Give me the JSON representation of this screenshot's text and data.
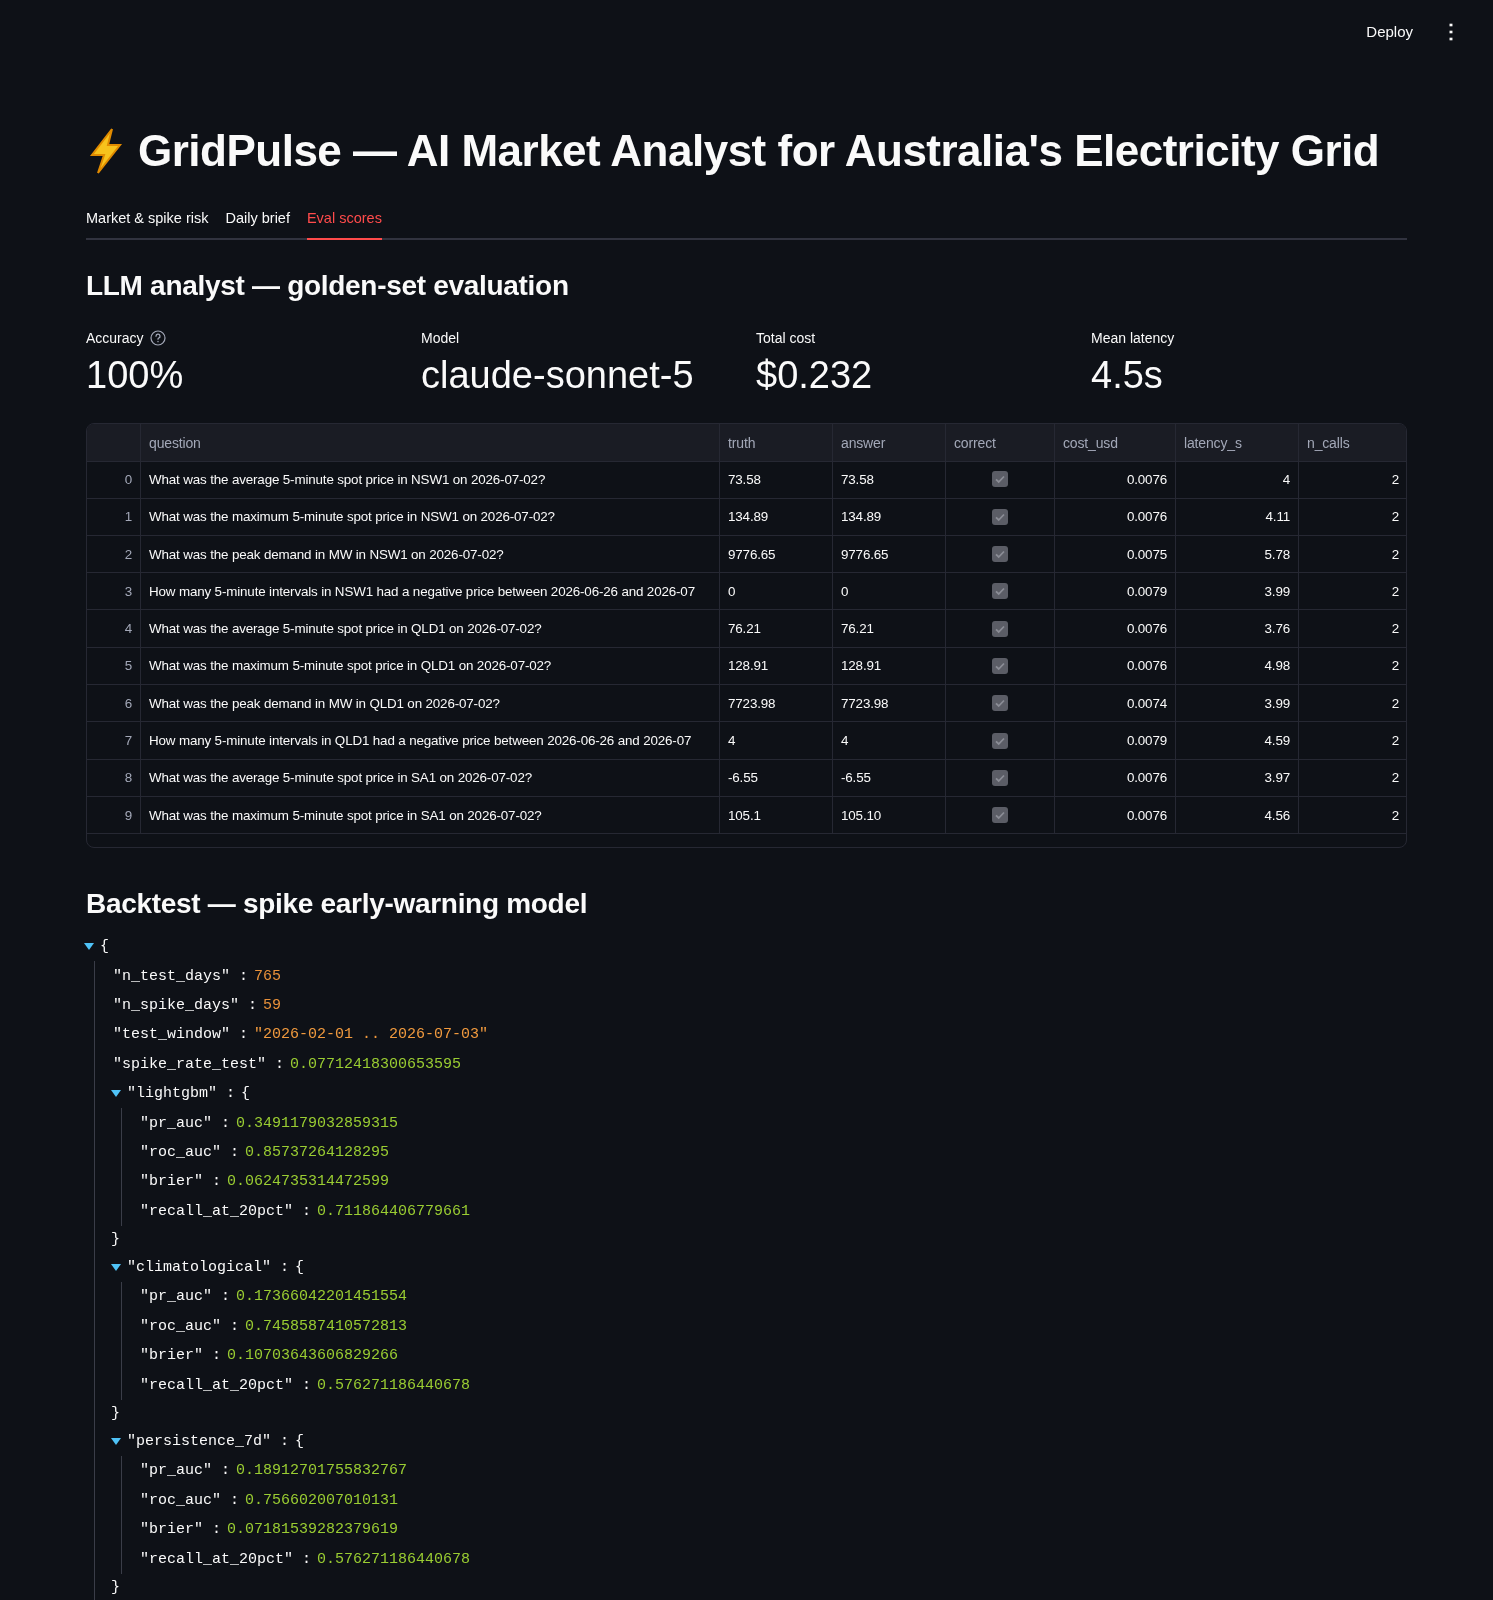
{
  "header": {
    "deploy": "Deploy",
    "menu": "⋮"
  },
  "title": "GridPulse — AI Market Analyst for Australia's Electricity Grid",
  "tabs": [
    {
      "label": "Market & spike risk",
      "selected": false
    },
    {
      "label": "Daily brief",
      "selected": false
    },
    {
      "label": "Eval scores",
      "selected": true
    }
  ],
  "eval_heading": "LLM analyst — golden-set evaluation",
  "metrics": [
    {
      "label": "Accuracy",
      "value": "100%",
      "help": true
    },
    {
      "label": "Model",
      "value": "claude-sonnet-5",
      "help": false
    },
    {
      "label": "Total cost",
      "value": "$0.232",
      "help": false
    },
    {
      "label": "Mean latency",
      "value": "4.5s",
      "help": false
    }
  ],
  "table": {
    "columns": [
      "question",
      "truth",
      "answer",
      "correct",
      "cost_usd",
      "latency_s",
      "n_calls"
    ],
    "rows": [
      {
        "index": "0",
        "question": "What was the average 5-minute spot price in NSW1 on 2026-07-02?",
        "truth": "73.58",
        "answer": "73.58",
        "correct": true,
        "cost_usd": "0.0076",
        "latency_s": "4",
        "n_calls": "2"
      },
      {
        "index": "1",
        "question": "What was the maximum 5-minute spot price in NSW1 on 2026-07-02?",
        "truth": "134.89",
        "answer": "134.89",
        "correct": true,
        "cost_usd": "0.0076",
        "latency_s": "4.11",
        "n_calls": "2"
      },
      {
        "index": "2",
        "question": "What was the peak demand in MW in NSW1 on 2026-07-02?",
        "truth": "9776.65",
        "answer": "9776.65",
        "correct": true,
        "cost_usd": "0.0075",
        "latency_s": "5.78",
        "n_calls": "2"
      },
      {
        "index": "3",
        "question": "How many 5-minute intervals in NSW1 had a negative price between 2026-06-26 and 2026-07",
        "truth": "0",
        "answer": "0",
        "correct": true,
        "cost_usd": "0.0079",
        "latency_s": "3.99",
        "n_calls": "2"
      },
      {
        "index": "4",
        "question": "What was the average 5-minute spot price in QLD1 on 2026-07-02?",
        "truth": "76.21",
        "answer": "76.21",
        "correct": true,
        "cost_usd": "0.0076",
        "latency_s": "3.76",
        "n_calls": "2"
      },
      {
        "index": "5",
        "question": "What was the maximum 5-minute spot price in QLD1 on 2026-07-02?",
        "truth": "128.91",
        "answer": "128.91",
        "correct": true,
        "cost_usd": "0.0076",
        "latency_s": "4.98",
        "n_calls": "2"
      },
      {
        "index": "6",
        "question": "What was the peak demand in MW in QLD1 on 2026-07-02?",
        "truth": "7723.98",
        "answer": "7723.98",
        "correct": true,
        "cost_usd": "0.0074",
        "latency_s": "3.99",
        "n_calls": "2"
      },
      {
        "index": "7",
        "question": "How many 5-minute intervals in QLD1 had a negative price between 2026-06-26 and 2026-07",
        "truth": "4",
        "answer": "4",
        "correct": true,
        "cost_usd": "0.0079",
        "latency_s": "4.59",
        "n_calls": "2"
      },
      {
        "index": "8",
        "question": "What was the average 5-minute spot price in SA1 on 2026-07-02?",
        "truth": "-6.55",
        "answer": "-6.55",
        "correct": true,
        "cost_usd": "0.0076",
        "latency_s": "3.97",
        "n_calls": "2"
      },
      {
        "index": "9",
        "question": "What was the maximum 5-minute spot price in SA1 on 2026-07-02?",
        "truth": "105.1",
        "answer": "105.10",
        "correct": true,
        "cost_usd": "0.0076",
        "latency_s": "4.56",
        "n_calls": "2"
      }
    ]
  },
  "backtest_heading": "Backtest — spike early-warning model",
  "json_tree": {
    "open": "{",
    "expanded": true,
    "children": [
      {
        "key": "\"n_test_days\" :",
        "value": "765",
        "kind": "int"
      },
      {
        "key": "\"n_spike_days\" :",
        "value": "59",
        "kind": "int"
      },
      {
        "key": "\"test_window\" :",
        "value": "\"2026-02-01 .. 2026-07-03\"",
        "kind": "string"
      },
      {
        "key": "\"spike_rate_test\" :",
        "value": "0.07712418300653595",
        "kind": "float"
      },
      {
        "key": "\"lightgbm\" :",
        "open": "{",
        "close": "}",
        "expanded": true,
        "kind": "object",
        "children": [
          {
            "key": "\"pr_auc\" :",
            "value": "0.3491179032859315",
            "kind": "float"
          },
          {
            "key": "\"roc_auc\" :",
            "value": "0.85737264128295",
            "kind": "float"
          },
          {
            "key": "\"brier\" :",
            "value": "0.0624735314472599",
            "kind": "float"
          },
          {
            "key": "\"recall_at_20pct\" :",
            "value": "0.711864406779661",
            "kind": "float"
          }
        ]
      },
      {
        "key": "\"climatological\" :",
        "open": "{",
        "close": "}",
        "expanded": true,
        "kind": "object",
        "children": [
          {
            "key": "\"pr_auc\" :",
            "value": "0.17366042201451554",
            "kind": "float"
          },
          {
            "key": "\"roc_auc\" :",
            "value": "0.7458587410572813",
            "kind": "float"
          },
          {
            "key": "\"brier\" :",
            "value": "0.10703643606829266",
            "kind": "float"
          },
          {
            "key": "\"recall_at_20pct\" :",
            "value": "0.576271186440678",
            "kind": "float"
          }
        ]
      },
      {
        "key": "\"persistence_7d\" :",
        "open": "{",
        "close": "}",
        "expanded": true,
        "kind": "object",
        "children": [
          {
            "key": "\"pr_auc\" :",
            "value": "0.18912701755832767",
            "kind": "float"
          },
          {
            "key": "\"roc_auc\" :",
            "value": "0.756602007010131",
            "kind": "float"
          },
          {
            "key": "\"brier\" :",
            "value": "0.07181539282379619",
            "kind": "float"
          },
          {
            "key": "\"recall_at_20pct\" :",
            "value": "0.576271186440678",
            "kind": "float"
          }
        ]
      }
    ]
  }
}
